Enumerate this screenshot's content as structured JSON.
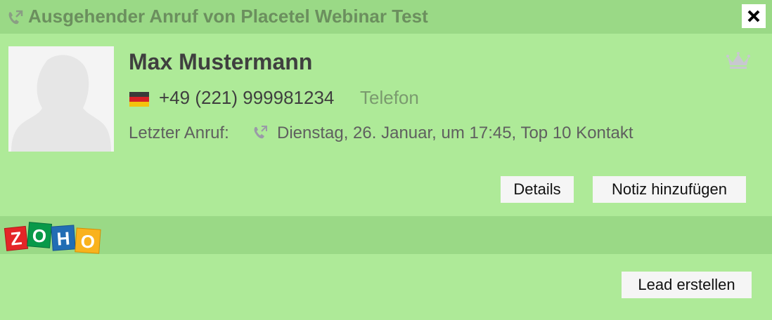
{
  "window": {
    "title": "Ausgehender Anruf von Placetel Webinar Test",
    "title_icon": "outgoing-call-icon",
    "close_icon": "close-icon"
  },
  "contact": {
    "name": "Max Mustermann",
    "avatar_icon": "person-silhouette-icon",
    "flag_icon": "germany-flag-icon",
    "phone": "+49 (221) 999981234",
    "phone_type": "Telefon",
    "last_call_label": "Letzter Anruf:",
    "last_call_icon": "outgoing-call-icon",
    "last_call_value": "Dienstag, 26. Januar, um 17:45, Top 10 Kontakt",
    "vip_icon": "crown-icon"
  },
  "actions": {
    "details_label": "Details",
    "add_note_label": "Notiz hinzufügen"
  },
  "integration": {
    "logo": "ZOHO",
    "create_lead_label": "Lead erstellen"
  },
  "colors": {
    "background": "#aeea98",
    "bar": "#9ad986",
    "title_text": "#6b8f5e",
    "button_bg": "#f5f5f5"
  }
}
